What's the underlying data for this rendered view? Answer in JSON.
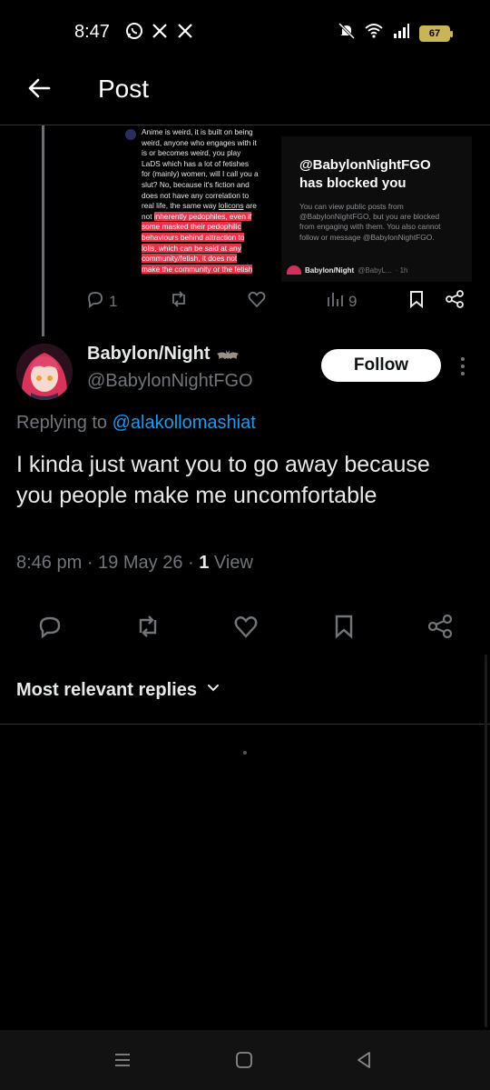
{
  "status_bar": {
    "time": "8:47",
    "battery": "67",
    "left_icons": [
      "whatsapp-icon",
      "x-icon",
      "x-icon"
    ],
    "right_icons": [
      "mute-icon",
      "wifi-icon",
      "signal-icon",
      "battery-icon"
    ]
  },
  "header": {
    "title": "Post",
    "back_icon": "arrow-left-icon"
  },
  "quoted_post": {
    "image_left_lines": [
      "Anime is weird, it is built on being",
      "weird, anyone who engages with it",
      "is or becomes weird, you play",
      "LaDS which has a lot of fetishes",
      "for (mainly) women, will I call you a",
      "slut? No, because it's fiction and",
      "does not have any correlation to",
      "real life, the same way ",
      "lolicons",
      " are",
      "not ",
      "inherently pedophiles, even if",
      "some masked their pedophilic",
      "behaviours behind attraction to",
      "lolis, which can be said at any",
      "community/fetish, it does not",
      "make the community or the fetish"
    ],
    "image_right": {
      "title_line1": "@BabylonNightFGO",
      "title_line2": "has blocked you",
      "body": "You can view public posts from @BabylonNightFGO, but you are blocked from engaging with them. You also cannot follow or message @BabylonNightFGO.",
      "footer_name": "Babylon/Night",
      "footer_handle": "@BabyL...",
      "footer_time": "· 1h"
    },
    "actions": {
      "reply_count": "1",
      "views_count": "9"
    }
  },
  "post": {
    "author_name": "Babylon/Night",
    "author_handle": "@BabylonNightFGO",
    "follow_label": "Follow",
    "replying_prefix": "Replying to ",
    "replying_handle": "@alakollomashiat",
    "text": "I kinda just want you to go away because you people make me uncomfortable",
    "time": "8:46 pm",
    "date": "19 May 26",
    "views_count": "1",
    "views_label": " View",
    "sep": " · "
  },
  "replies": {
    "sort_label": "Most relevant replies"
  },
  "colors": {
    "background": "#000000",
    "link": "#1d9bf0",
    "muted": "#71767b",
    "highlight": "#e3344a"
  }
}
